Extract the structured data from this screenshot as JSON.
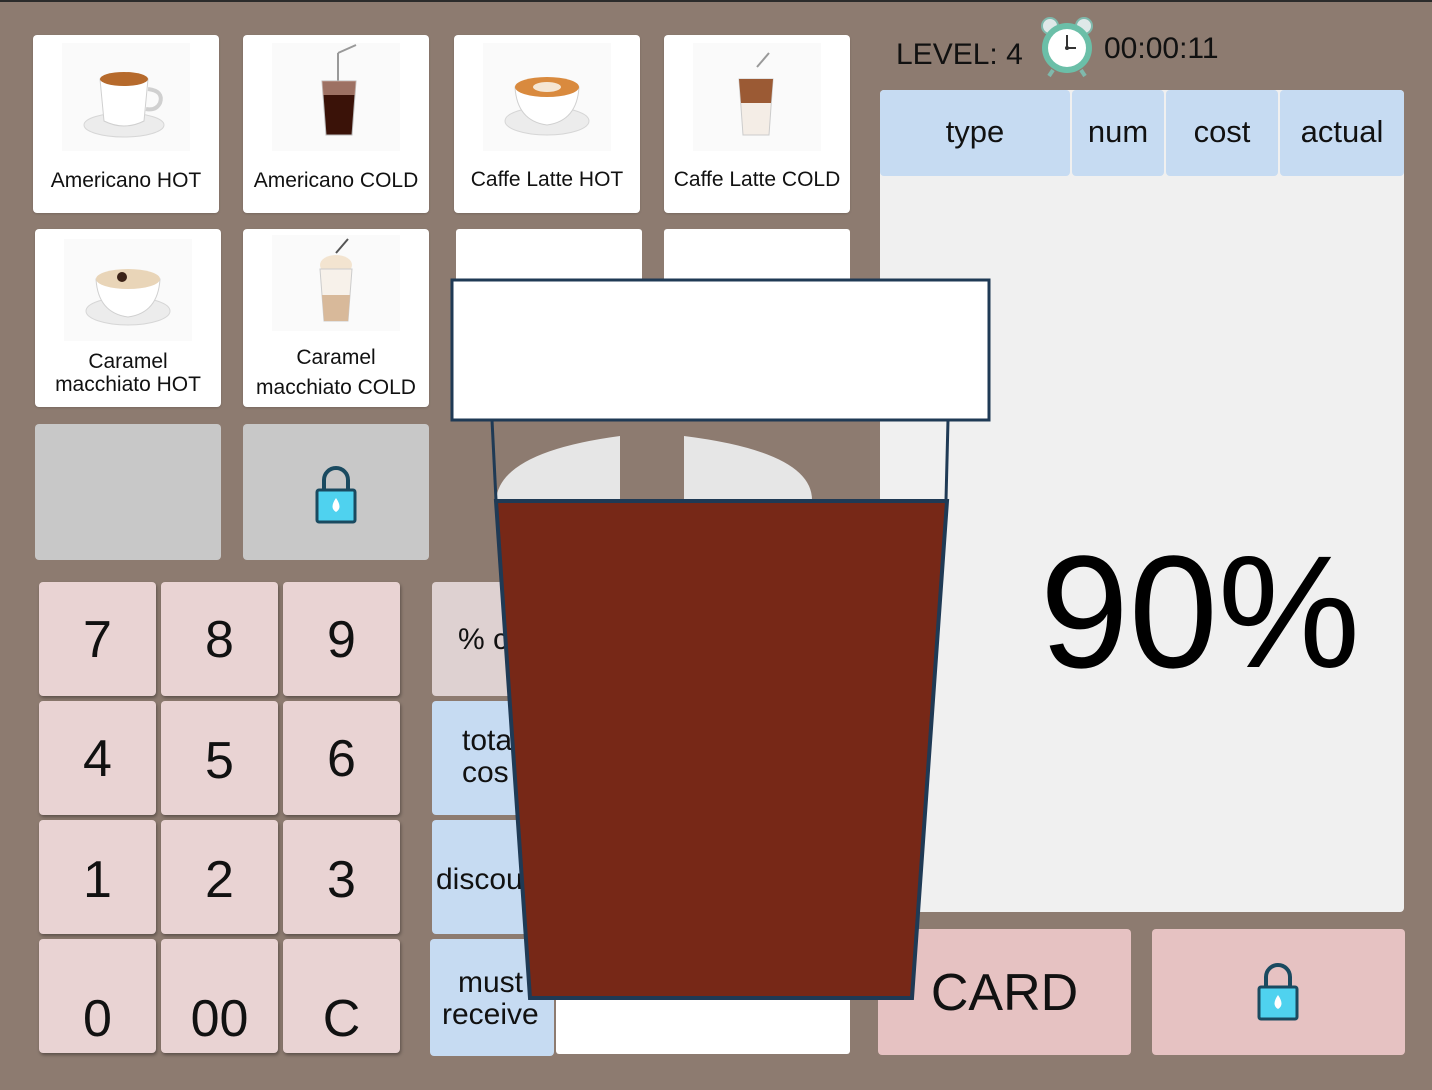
{
  "header": {
    "level_label": "LEVEL: 4",
    "timer": "00:00:11"
  },
  "menu": {
    "items": [
      {
        "label": "Americano HOT"
      },
      {
        "label": "Americano COLD"
      },
      {
        "label": "Caffe Latte HOT"
      },
      {
        "label": "Caffe Latte COLD"
      },
      {
        "label_line1": "Caramel",
        "label_line2": "macchiato HOT"
      },
      {
        "label_line1": "Caramel",
        "label_line2": "macchiato COLD"
      }
    ]
  },
  "keypad": {
    "keys": [
      "7",
      "8",
      "9",
      "4",
      "5",
      "6",
      "1",
      "2",
      "3",
      "0",
      "00",
      "C"
    ]
  },
  "functions": {
    "percent_partial": "% c",
    "total_cost_line1": "tota",
    "total_cost_line2": "cos",
    "discount_partial": "discou",
    "must_receive_line1": "must",
    "must_receive_line2": "receive"
  },
  "order_table": {
    "columns": [
      "type",
      "num",
      "cost",
      "actual"
    ]
  },
  "progress": {
    "display": "90%",
    "fill_fraction": 0.9
  },
  "payment": {
    "card_label": "CARD"
  },
  "colors": {
    "background": "#8d7b70",
    "coffee": "#772817",
    "key": "#e9d3d3",
    "header_blue": "#c6dbf2",
    "pay_button": "#e6c2c2",
    "lock_blue": "#4fd2ef"
  }
}
